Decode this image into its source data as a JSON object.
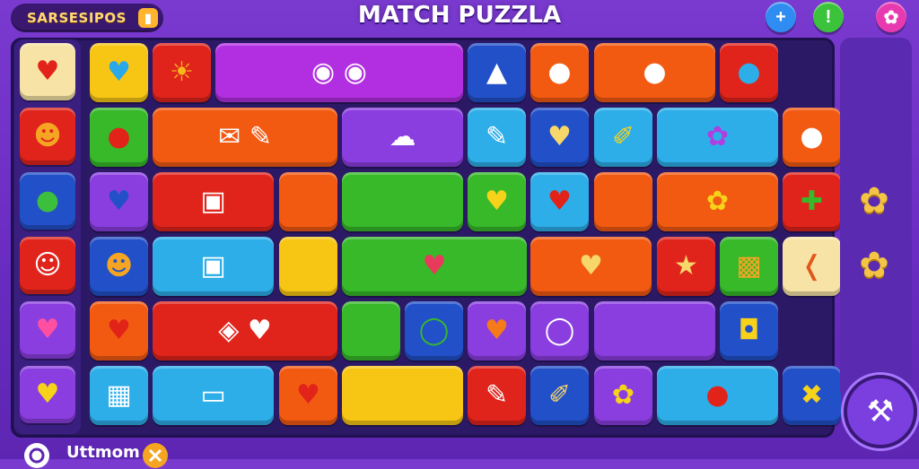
{
  "header": {
    "badge_text": "SARSESIPOS",
    "badge_icon": "trophy-icon",
    "title": "MATCH PUZZLA",
    "buttons": [
      {
        "name": "add-button",
        "glyph": "+",
        "color": "#2f8cf0"
      },
      {
        "name": "info-button",
        "glyph": "!",
        "color": "#3cc33c"
      },
      {
        "name": "settings-button",
        "glyph": "✿",
        "color": "#e83ab0"
      }
    ]
  },
  "colors": {
    "red": "#e0241c",
    "orange": "#f25a12",
    "yellow": "#f7c614",
    "green": "#37b92a",
    "blue": "#2250c8",
    "cyan": "#2eaee8",
    "purple": "#8b3ee0",
    "magenta": "#b12fe0",
    "cream": "#f7e3a6"
  },
  "left_column": [
    {
      "color": "cream",
      "icon": "heart-icon",
      "glyph": "♥",
      "glyph_color": "#e2231a"
    },
    {
      "color": "red",
      "icon": "face-icon",
      "glyph": "☻",
      "glyph_color": "#f5a522"
    },
    {
      "color": "blue",
      "icon": "chat-bubble-icon",
      "glyph": "●",
      "glyph_color": "#3cbf3c"
    },
    {
      "color": "red",
      "icon": "smiley-icon",
      "glyph": "☺",
      "glyph_color": "#ffffff"
    },
    {
      "color": "purple",
      "icon": "heart-icon",
      "glyph": "♥",
      "glyph_color": "#ff4fa0"
    },
    {
      "color": "purple",
      "icon": "heart-icon",
      "glyph": "♥",
      "glyph_color": "#f7d21a"
    }
  ],
  "grid_rows": [
    [
      {
        "span": 1,
        "color": "yellow",
        "icon": "heart-icon",
        "glyph": "♥",
        "glyph_color": "#2aa8e8"
      },
      {
        "span": 1,
        "color": "red",
        "icon": "sun-icon",
        "glyph": "☀",
        "glyph_color": "#f6b81a"
      },
      {
        "span": 4,
        "color": "magenta",
        "icon": "button-icon",
        "glyph": "◉  ◉",
        "glyph_color": "#ffffff"
      },
      {
        "span": 1,
        "color": "blue",
        "icon": "bell-icon",
        "glyph": "▲",
        "glyph_color": "#ffffff"
      },
      {
        "span": 1,
        "color": "orange",
        "icon": "cookie-icon",
        "glyph": "●",
        "glyph_color": "#ffffff"
      },
      {
        "span": 2,
        "color": "orange",
        "icon": "cookie-icon",
        "glyph": "●",
        "glyph_color": "#ffffff"
      },
      {
        "span": 1,
        "color": "red",
        "icon": "circle-icon",
        "glyph": "●",
        "glyph_color": "#2eaee8"
      }
    ],
    [
      {
        "span": 1,
        "color": "green",
        "icon": "apple-icon",
        "glyph": "●",
        "glyph_color": "#e2231a"
      },
      {
        "span": 3,
        "color": "orange",
        "icon": "envelope-icon",
        "glyph": "✉   ✎",
        "glyph_color": "#ffffff"
      },
      {
        "span": 2,
        "color": "purple",
        "icon": "speech-bubble-icon",
        "glyph": "☁",
        "glyph_color": "#ffffff"
      },
      {
        "span": 1,
        "color": "cyan",
        "icon": "brush-icon",
        "glyph": "✎",
        "glyph_color": "#ffffff"
      },
      {
        "span": 1,
        "color": "blue",
        "icon": "heart-icon",
        "glyph": "♥",
        "glyph_color": "#f7d66a"
      },
      {
        "span": 1,
        "color": "cyan",
        "icon": "spoon-icon",
        "glyph": "✐",
        "glyph_color": "#f7d21a"
      },
      {
        "span": 2,
        "color": "cyan",
        "icon": "flower-icon",
        "glyph": "✿",
        "glyph_color": "#b03ee0"
      },
      {
        "span": 1,
        "color": "orange",
        "icon": "shell-icon",
        "glyph": "●",
        "glyph_color": "#ffffff"
      }
    ],
    [
      {
        "span": 1,
        "color": "purple",
        "icon": "heart-icon",
        "glyph": "♥",
        "glyph_color": "#2250c8"
      },
      {
        "span": 2,
        "color": "red",
        "icon": "chat-icon",
        "glyph": "▣",
        "glyph_color": "#ffffff"
      },
      {
        "span": 1,
        "color": "orange",
        "icon": "blank-icon",
        "glyph": "",
        "glyph_color": "#ffffff"
      },
      {
        "span": 2,
        "color": "green",
        "icon": "blank-icon",
        "glyph": "",
        "glyph_color": "#ffffff"
      },
      {
        "span": 1,
        "color": "green",
        "icon": "heart-icon",
        "glyph": "♥",
        "glyph_color": "#f7d21a"
      },
      {
        "span": 1,
        "color": "cyan",
        "icon": "heart-icon",
        "glyph": "♥",
        "glyph_color": "#e2231a"
      },
      {
        "span": 1,
        "color": "orange",
        "icon": "blank-icon",
        "glyph": "",
        "glyph_color": "#ffffff"
      },
      {
        "span": 2,
        "color": "orange",
        "icon": "flower-icon",
        "glyph": "✿",
        "glyph_color": "#f7d21a"
      },
      {
        "span": 1,
        "color": "red",
        "icon": "pin-icon",
        "glyph": "✚",
        "glyph_color": "#37b92a"
      }
    ],
    [
      {
        "span": 1,
        "color": "blue",
        "icon": "smiley-icon",
        "glyph": "☻",
        "glyph_color": "#f5a522"
      },
      {
        "span": 2,
        "color": "cyan",
        "icon": "eyes-icon",
        "glyph": "▣",
        "glyph_color": "#ffffff"
      },
      {
        "span": 1,
        "color": "yellow",
        "icon": "blank-icon",
        "glyph": "",
        "glyph_color": "#ffffff"
      },
      {
        "span": 3,
        "color": "green",
        "icon": "heart-icon",
        "glyph": "♥",
        "glyph_color": "#e83a5a"
      },
      {
        "span": 2,
        "color": "orange",
        "icon": "heart-icon",
        "glyph": "♥",
        "glyph_color": "#f7d66a"
      },
      {
        "span": 1,
        "color": "red",
        "icon": "star-icon",
        "glyph": "★",
        "glyph_color": "#f7d66a"
      },
      {
        "span": 1,
        "color": "green",
        "icon": "cube-icon",
        "glyph": "▩",
        "glyph_color": "#f5a522"
      },
      {
        "span": 1,
        "color": "cream",
        "icon": "sausage-icon",
        "glyph": "❬",
        "glyph_color": "#e2561a"
      }
    ],
    [
      {
        "span": 1,
        "color": "orange",
        "icon": "heart-icon",
        "glyph": "♥",
        "glyph_color": "#e2231a"
      },
      {
        "span": 3,
        "color": "red",
        "icon": "cube-icon",
        "glyph": "◈      ♥",
        "glyph_color": "#ffffff"
      },
      {
        "span": 1,
        "color": "green",
        "icon": "blank-icon",
        "glyph": "",
        "glyph_color": "#ffffff"
      },
      {
        "span": 1,
        "color": "blue",
        "icon": "ring-icon",
        "glyph": "◯",
        "glyph_color": "#37b92a"
      },
      {
        "span": 1,
        "color": "purple",
        "icon": "heart-icon",
        "glyph": "♥",
        "glyph_color": "#f57a1a"
      },
      {
        "span": 1,
        "color": "purple",
        "icon": "ring-icon",
        "glyph": "◯",
        "glyph_color": "#ffffff"
      },
      {
        "span": 2,
        "color": "purple",
        "icon": "blank-icon",
        "glyph": "",
        "glyph_color": "#ffffff"
      },
      {
        "span": 1,
        "color": "blue",
        "icon": "jar-icon",
        "glyph": "◘",
        "glyph_color": "#f7d21a"
      }
    ],
    [
      {
        "span": 1,
        "color": "cyan",
        "icon": "pattern-icon",
        "glyph": "▦",
        "glyph_color": "#ffffff"
      },
      {
        "span": 2,
        "color": "cyan",
        "icon": "card-icon",
        "glyph": "▭",
        "glyph_color": "#ffffff"
      },
      {
        "span": 1,
        "color": "orange",
        "icon": "heart-icon",
        "glyph": "♥",
        "glyph_color": "#e2231a"
      },
      {
        "span": 2,
        "color": "yellow",
        "icon": "blank-icon",
        "glyph": "",
        "glyph_color": "#ffffff"
      },
      {
        "span": 1,
        "color": "red",
        "icon": "pin-icon",
        "glyph": "✎",
        "glyph_color": "#ffffff"
      },
      {
        "span": 1,
        "color": "blue",
        "icon": "bandage-icon",
        "glyph": "✐",
        "glyph_color": "#f7d66a"
      },
      {
        "span": 1,
        "color": "purple",
        "icon": "flower-icon",
        "glyph": "✿",
        "glyph_color": "#f7d21a"
      },
      {
        "span": 2,
        "color": "cyan",
        "icon": "cherry-icon",
        "glyph": "●",
        "glyph_color": "#e2231a"
      },
      {
        "span": 1,
        "color": "blue",
        "icon": "hammer-icon",
        "glyph": "✖",
        "glyph_color": "#f7d21a"
      }
    ]
  ],
  "side_panel": {
    "items": [
      {
        "icon": "flower-icon",
        "glyph": "✿"
      },
      {
        "icon": "flower-icon",
        "glyph": "✿"
      }
    ],
    "action_icon": "hammer-icon",
    "action_glyph": "⚒"
  },
  "footer": {
    "text": "Uttmom",
    "left_icon": "refresh-icon",
    "right_icon": "close-icon"
  }
}
